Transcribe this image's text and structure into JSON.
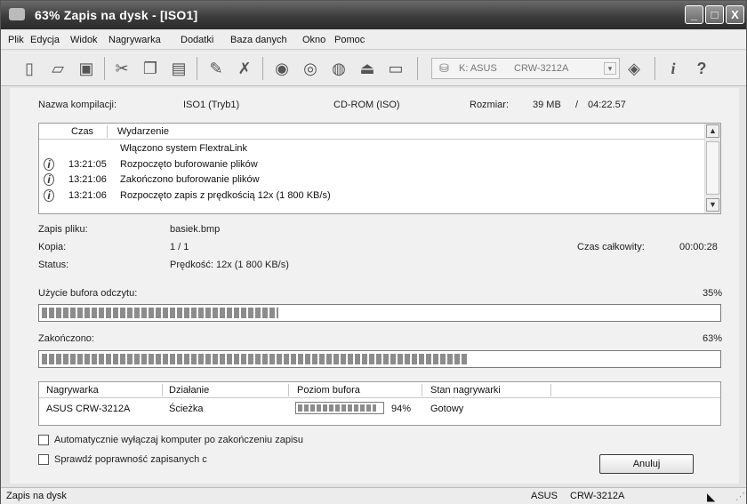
{
  "window": {
    "title": "63% Zapis na dysk - [ISO1]",
    "btn_min": "_",
    "btn_max": "□",
    "btn_close": "X"
  },
  "menu": [
    "Plik",
    "Edycja",
    "Widok",
    "Nagrywarka",
    "Dodatki",
    "Baza danych",
    "Okno",
    "Pomoc"
  ],
  "toolbar": {
    "drive_letter": "K: ASUS",
    "drive_model": "CRW-3212A"
  },
  "compilation": {
    "label": "Nazwa kompilacji:",
    "name": "ISO1 (Tryb1)",
    "type": "CD-ROM (ISO)",
    "size_label": "Rozmiar:",
    "size": "39 MB",
    "slash": "/",
    "duration": "04:22.57"
  },
  "log": {
    "col_time": "Czas",
    "col_event": "Wydarzenie",
    "entries": [
      {
        "time": "",
        "event": "Włączono system FlextraLink",
        "icon": false
      },
      {
        "time": "13:21:05",
        "event": "Rozpoczęto buforowanie plików",
        "icon": true
      },
      {
        "time": "13:21:06",
        "event": "Zakończono buforowanie plików",
        "icon": true
      },
      {
        "time": "13:21:06",
        "event": "Rozpoczęto zapis z prędkością 12x (1 800 KB/s)",
        "icon": true
      }
    ]
  },
  "details": {
    "file_label": "Zapis pliku:",
    "file": "basiek.bmp",
    "copy_label": "Kopia:",
    "copy": "1 / 1",
    "total_label": "Czas całkowity:",
    "total": "00:00:28",
    "status_label": "Status:",
    "status": "Prędkość: 12x (1 800 KB/s)"
  },
  "buffer": {
    "label": "Użycie bufora odczytu:",
    "percent_text": "35%",
    "fraction": 0.35
  },
  "progress": {
    "label": "Zakończono:",
    "percent_text": "63%",
    "fraction": 0.63
  },
  "recorders": {
    "headers": [
      "Nagrywarka",
      "Działanie",
      "Poziom bufora",
      "Stan nagrywarki"
    ],
    "row": {
      "name": "ASUS CRW-3212A",
      "action": "Ścieżka",
      "buffer_text": "94%",
      "buffer_fraction": 0.94,
      "state": "Gotowy"
    }
  },
  "options": {
    "shutdown": "Automatycznie wyłączaj komputer po zakończeniu zapisu",
    "verify": "Sprawdź poprawność zapisanych c"
  },
  "cancel_button": "Anuluj",
  "statusbar": {
    "left": "Zapis na dysk",
    "brand": "ASUS",
    "model": "CRW-3212A"
  }
}
